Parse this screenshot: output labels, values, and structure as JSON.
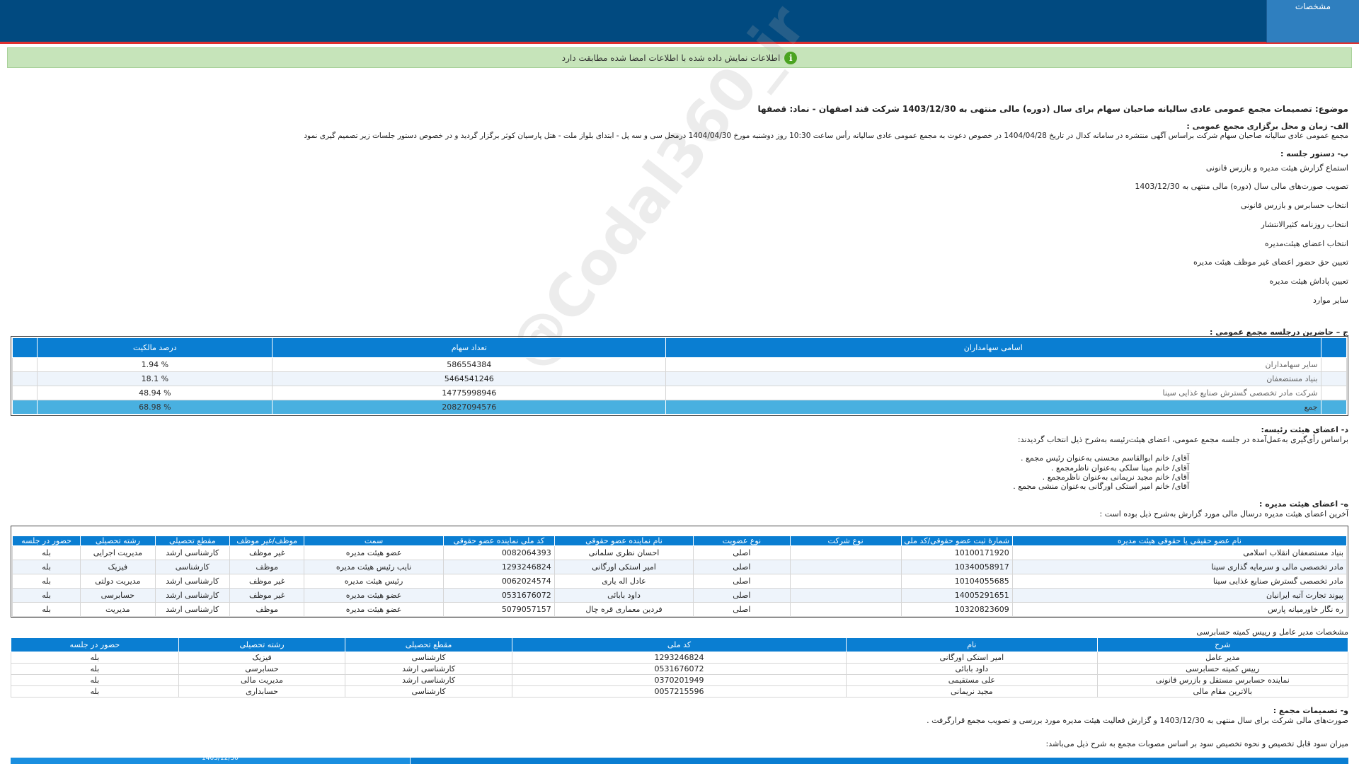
{
  "header": {
    "tab_label": "مشخصات"
  },
  "notice": {
    "text": "اطلاعات نمایش داده شده با اطلاعات امضا شده مطابقت دارد",
    "icon": "info-icon"
  },
  "watermark": "@Codal360_ir",
  "subject": "موضوع: تصمیمات مجمع عمومی عادی سالیانه صاحبان سهام برای سال (دوره) مالی منتهی به 1403/12/30 شرکت قند اصفهان - نماد: قصفها",
  "section_a": {
    "title": "الف- زمان و محل برگزاری مجمع عمومی :",
    "text": "مجمع عمومی عادی سالیانه صاحبان سهام شرکت براساس آگهی منتشره در سامانه کدال در تاریخ 1404/04/28 در خصوص دعوت به مجمع عمومی عادی سالیانه رأس ساعت 10:30 روز دوشنبه مورخ 1404/04/30 درمحل  سی و سه پل - ابتدای بلواز ملت - هتل پارسیان کوثر   برگزار گردید و در خصوص دستور جلسات زیر تصمیم گیری نمود"
  },
  "section_b": {
    "title": "ب- دستور جلسه :",
    "items": [
      "استماع گزارش هیئت مدیره و بازرس قانونی",
      "تصویب صورت‌های مالی سال (دوره) مالی منتهی به 1403/12/30",
      "انتخاب حسابرس و بازرس قانونی",
      "انتخاب روزنامه کثیرالانتشار",
      "انتخاب اعضای هیئت‌مدیره",
      "تعیین حق حضور اعضای غیر موظف هیئت مدیره",
      "تعیین پاداش هیئت مدیره",
      "سایر موارد"
    ]
  },
  "section_c": {
    "title": "ج – حاضرین درجلسه مجمع عمومی :",
    "headers": [
      "اسامی سهامداران",
      "تعداد سهام",
      "درصد مالکیت"
    ],
    "rows": [
      [
        "سایر سهامداران",
        "586554384",
        "% 1.94"
      ],
      [
        "بنیاد مستضعفان",
        "5464541246",
        "% 18.1"
      ],
      [
        "شرکت مادر تخصصی گسترش صنایع غذایی سینا",
        "14775998946",
        "% 48.94"
      ]
    ],
    "total": [
      "جمع",
      "20827094576",
      "% 68.98"
    ]
  },
  "section_d": {
    "title": "د- اعضای هیئت رئیسه:",
    "intro": "براساس رأی‌گیری به‌عمل‌آمده در جلسه مجمع عمومی، اعضای هیئت‌رئیسه به‌شرح ذیل انتخاب گردیدند:",
    "items": [
      "آقای/ خانم  ابوالقاسم محسنی  به‌عنوان رئیس مجمع .",
      "آقای/ خانم  مینا سلکی  به‌عنوان ناظرمجمع .",
      "آقای/ خانم  مجید نریمانی  به‌عنوان ناظرمجمع .",
      "آقای/ خانم  امیر استکی اورگانی  به‌عنوان منشی مجمع ."
    ]
  },
  "section_e": {
    "title": "ه- اعضای هیئت مدیره :",
    "intro": "آخرین اعضای هیئت مدیره درسال مالی مورد گزارش به‌شرح ذیل بوده است :",
    "headers": [
      "نام عضو حقیقی یا حقوقی هیئت مدیره",
      "شمارهٔ ثبت عضو حقوقی/کد ملی",
      "نوع شرکت",
      "نوع عضویت",
      "نام نماینده عضو حقوقی",
      "کد ملی نماینده عضو حقوقی",
      "سمت",
      "موظف/غیر موظف",
      "مقطع تحصیلی",
      "رشته تحصیلی",
      "حضور در جلسه"
    ],
    "rows": [
      [
        "بنیاد مستضعفان انقلاب اسلامی",
        "10100171920",
        "",
        "اصلی",
        "احسان نظری سلمانی",
        "0082064393",
        "عضو هیئت مدیره",
        "غیر موظف",
        "کارشناسی ارشد",
        "مدیریت اجرایی",
        "بله"
      ],
      [
        "مادر تخصصی مالی و سرمایه گذاری سینا",
        "10340058917",
        "",
        "اصلی",
        "امیر استکی اورگانی",
        "1293246824",
        "نایب رئیس هیئت مدیره",
        "موظف",
        "کارشناسی",
        "فیزیک",
        "بله"
      ],
      [
        "مادر تخصصی گسترش صنایع غذایی سینا",
        "10104055685",
        "",
        "اصلی",
        "عادل اله یاری",
        "0062024574",
        "رئیس هیئت مدیره",
        "غیر موظف",
        "کارشناسی ارشد",
        "مدیریت دولتی",
        "بله"
      ],
      [
        "پیوند تجارت آتیه ایرانیان",
        "14005291651",
        "",
        "اصلی",
        "داود بابائی",
        "0531676072",
        "عضو هیئت مدیره",
        "غیر موظف",
        "کارشناسی ارشد",
        "حسابرسی",
        "بله"
      ],
      [
        "ره نگار خاورمیانه پارس",
        "10320823609",
        "",
        "اصلی",
        "فردین معماری قره چال",
        "5079057157",
        "عضو هیئت مدیره",
        "موظف",
        "کارشناسی ارشد",
        "مدیریت",
        "بله"
      ]
    ]
  },
  "section_ceo": {
    "title": "مشخصات مدیر عامل و رییس کمیته حسابرسی",
    "headers": [
      "شرح",
      "نام",
      "کد ملی",
      "مقطع تحصیلی",
      "رشته تحصیلی",
      "حضور در جلسه"
    ],
    "rows": [
      [
        "مدیر عامل",
        "امیر استکی اورگانی",
        "1293246824",
        "کارشناسی",
        "فیزیک",
        "بله"
      ],
      [
        "رییس کمیته حسابرسی",
        "داود بابائی",
        "0531676072",
        "کارشناسی ارشد",
        "حسابرسی",
        "بله"
      ],
      [
        "نماینده حسابرس مستقل و بازرس قانونی",
        "علی مستقیمی",
        "0370201949",
        "کارشناسی ارشد",
        "مدیریت مالی",
        "بله"
      ],
      [
        "بالاترین مقام مالی",
        "مجید نریمانی",
        "0057215596",
        "کارشناسی",
        "حسابداری",
        "بله"
      ]
    ]
  },
  "section_f": {
    "title": "و- تصمیمات مجمع :",
    "text1": "صورت‌های مالی شرکت برای سال منتهی به  1403/12/30 و گزارش فعالیت هیئت مدیره مورد بررسی و تصویب مجمع قرارگرفت .",
    "text2": "میزان سود قابل تخصیص و نحوه تخصیص سود بر اساس مصوبات مجمع به شرح ذیل می‌باشد:",
    "next_header": "1403/12/30"
  }
}
